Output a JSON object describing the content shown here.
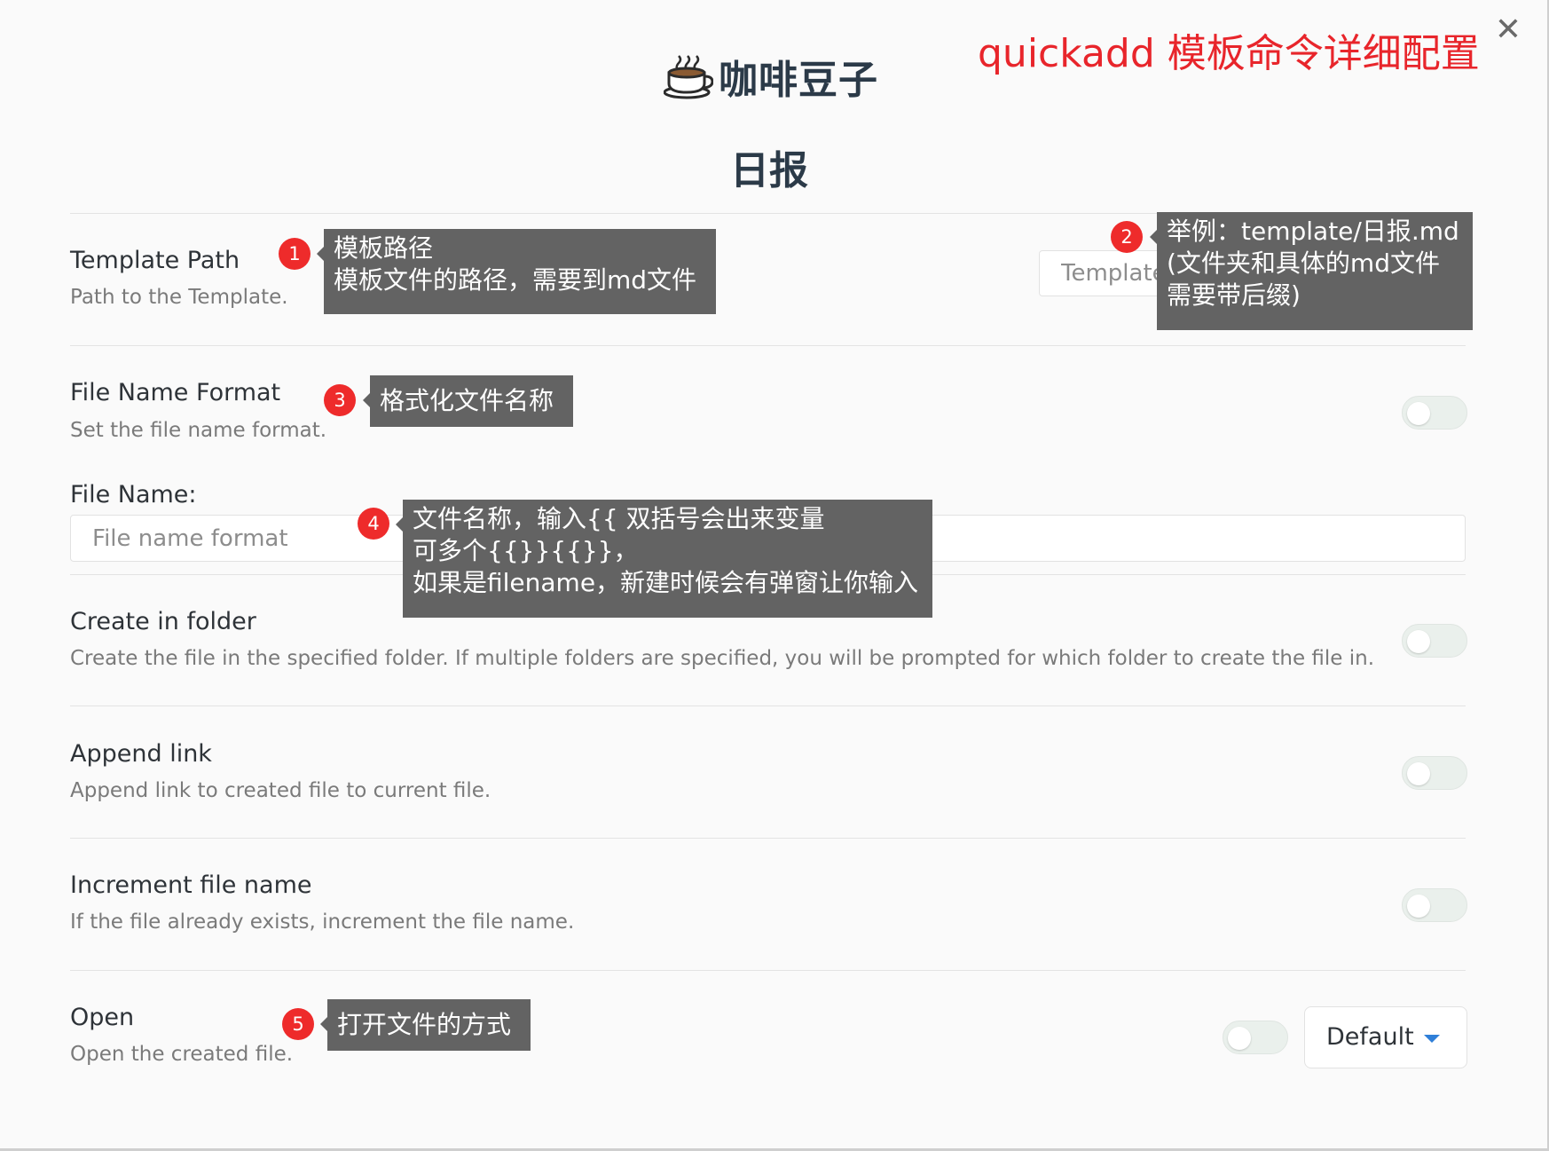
{
  "annotation_title": "quickadd 模板命令详细配置",
  "brand": {
    "name": "咖啡豆子",
    "icon": "coffee-cup-icon"
  },
  "close_icon": "close-icon",
  "page_title": "日报",
  "settings": {
    "template_path": {
      "name": "Template Path",
      "desc": "Path to the Template.",
      "placeholder": "Template path"
    },
    "file_name_format": {
      "name": "File Name Format",
      "desc": "Set the file name format."
    },
    "file_name": {
      "label": "File Name:",
      "placeholder": "File name format"
    },
    "create_in_folder": {
      "name": "Create in folder",
      "desc": "Create the file in the specified folder. If multiple folders are specified, you will be prompted for which folder to create the file in."
    },
    "append_link": {
      "name": "Append link",
      "desc": "Append link to created file to current file."
    },
    "increment_file_name": {
      "name": "Increment file name",
      "desc": "If the file already exists, increment the file name."
    },
    "open": {
      "name": "Open",
      "desc": "Open the created file.",
      "select_value": "Default"
    }
  },
  "annotations": [
    {
      "num": "1",
      "lines": [
        "模板路径",
        "模板文件的路径，需要到md文件"
      ]
    },
    {
      "num": "2",
      "lines": [
        "举例：template/日报.md",
        "(文件夹和具体的md文件",
        "需要带后缀)"
      ]
    },
    {
      "num": "3",
      "lines": [
        "格式化文件名称"
      ]
    },
    {
      "num": "4",
      "lines": [
        "文件名称，输入{{ 双括号会出来变量",
        "可多个{{}}{{}}，",
        "如果是filename，新建时候会有弹窗让你输入"
      ]
    },
    {
      "num": "5",
      "lines": [
        "打开文件的方式"
      ]
    }
  ],
  "colors": {
    "annotation_red": "#e8252b",
    "badge_red": "#ee2b2b",
    "tooltip_bg": "#636363",
    "dropdown_caret": "#2f7fd8"
  }
}
